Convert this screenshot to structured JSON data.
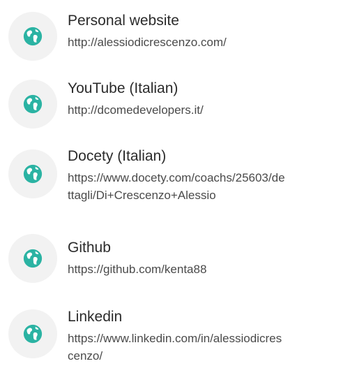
{
  "links": [
    {
      "title": "Personal website",
      "url": "http://alessiodicrescenzo.com/"
    },
    {
      "title": "YouTube (Italian)",
      "url": "http://dcomedevelopers.it/"
    },
    {
      "title": "Docety (Italian)",
      "url": "https://www.docety.com/coachs/25603/dettagli/Di+Crescenzo+Alessio"
    },
    {
      "title": "Github",
      "url": "https://github.com/kenta88"
    },
    {
      "title": "Linkedin",
      "url": "https://www.linkedin.com/in/alessiodicrescenzo/"
    }
  ],
  "icon": "globe-icon",
  "colors": {
    "icon_fill": "#2bb3a3",
    "icon_bg": "#f2f2f2",
    "title_text": "#2b2b2b",
    "url_text": "#4a4a4a"
  }
}
